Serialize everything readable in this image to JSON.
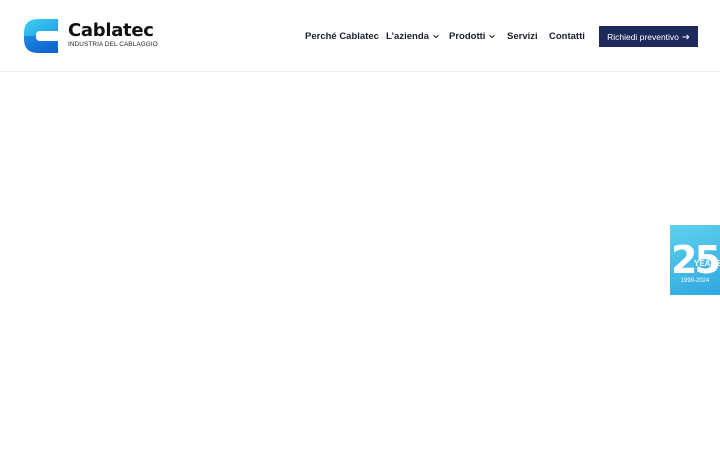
{
  "brand": {
    "name": "Cablatec",
    "tagline": "INDUSTRIA DEL CABLAGGIO",
    "colors": {
      "mark_top": "#2ec4ea",
      "mark_bottom": "#1a73d9",
      "navy": "#1f2a5c"
    }
  },
  "nav": {
    "items": [
      {
        "label": "Perché Cablatec",
        "has_dropdown": false
      },
      {
        "label": "L'azienda",
        "has_dropdown": true
      },
      {
        "label": "Prodotti",
        "has_dropdown": true
      },
      {
        "label": "Servizi",
        "has_dropdown": false
      },
      {
        "label": "Contatti",
        "has_dropdown": false
      }
    ],
    "dropdown_icon": "chevron-down-icon"
  },
  "cta": {
    "label": "Richiedi preventivo",
    "icon": "arrow-right-icon"
  },
  "anniversary_badge": {
    "number": "25",
    "unit": "YEARS",
    "years": "1999-2024",
    "color": "#3cb4e4"
  }
}
